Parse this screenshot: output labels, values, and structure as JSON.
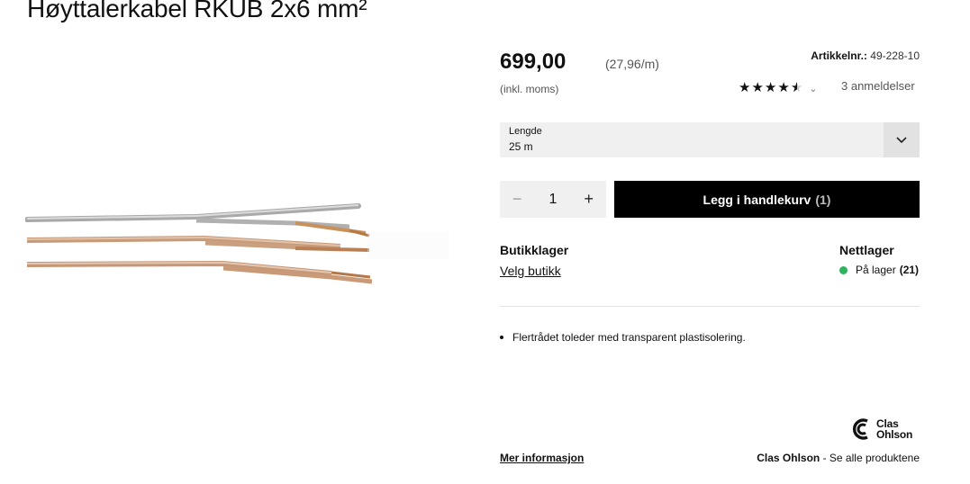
{
  "product": {
    "title": "Høyttalerkabel RKUB 2x6 mm²",
    "price": "699,00",
    "unit_price": "(27,96/m)",
    "vat_note": "(inkl. moms)",
    "article_label": "Artikkelnr.:",
    "article_number": "49-228-10",
    "rating_value": 4.5,
    "reviews_text": "3 anmeldelser",
    "features": [
      "Flertrådet toleder med transparent plastisolering."
    ]
  },
  "variant": {
    "label": "Lengde",
    "value": "25 m"
  },
  "quantity": {
    "minus": "−",
    "value": "1",
    "plus": "+"
  },
  "cart": {
    "label": "Legg i handlekurv",
    "count": "(1)"
  },
  "stock": {
    "store_heading": "Butikklager",
    "store_link": "Velg butikk",
    "web_heading": "Nettlager",
    "web_status": "På lager",
    "web_count": "(21)",
    "status_color": "#2eb35f"
  },
  "brand": {
    "logo_line1": "Clas",
    "logo_line2": "Ohlson",
    "more_info": "Mer informasjon",
    "name": "Clas Ohlson",
    "separator": " - ",
    "see_all": "Se alle produktene"
  },
  "icons": {
    "select_chevron": "chevron-down-icon",
    "rating_chevron": "chevron-down-icon",
    "stock_dot": "status-dot-icon",
    "star": "star-icon"
  }
}
